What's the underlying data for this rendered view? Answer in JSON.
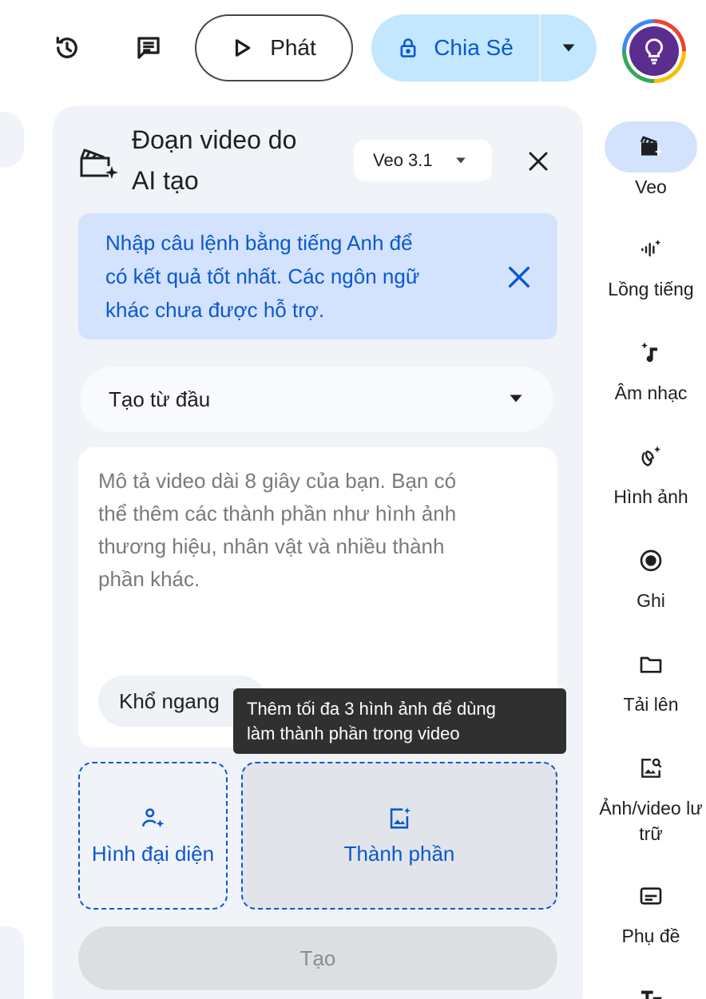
{
  "topbar": {
    "play_label": "Phát",
    "share_label": "Chia Sẻ"
  },
  "panel": {
    "title_line1": "Đoạn video do",
    "title_line2": "AI tạo",
    "model": "Veo 3.1",
    "info": {
      "line1": "Nhập câu lệnh bằng tiếng Anh để",
      "line2": "có kết quả tốt nhất. Các ngôn ngữ",
      "line3": "khác chưa được hỗ trợ."
    },
    "mode": "Tạo từ đầu",
    "prompt": {
      "placeholder_l1": "Mô tả video dài 8 giây của bạn. Bạn có",
      "placeholder_l2": "thể thêm các thành phần như hình ảnh",
      "placeholder_l3": "thương hiệu, nhân vật và nhiều thành",
      "placeholder_l4": "phần khác."
    },
    "aspect_label": "Khổ ngang",
    "tooltip_l1": "Thêm tối đa 3 hình ảnh để dùng",
    "tooltip_l2": "làm thành phần trong video",
    "avatar_slot": "Hình đại diện",
    "ingredient_slot": "Thành phần",
    "create_label": "Tạo"
  },
  "rail": {
    "veo": "Veo",
    "voiceover": "Lồng tiếng",
    "music": "Âm nhạc",
    "images": "Hình ảnh",
    "record": "Ghi",
    "upload": "Tải lên",
    "stock_l1": "Ảnh/video lư",
    "stock_l2": "trữ",
    "captions": "Phụ đề"
  },
  "colors": {
    "accent": "#0b57d0",
    "share_bg": "#c2e7ff",
    "panel_bg": "#f0f4f9",
    "banner_bg": "#d3e3fd",
    "tooltip_bg": "#303030"
  }
}
